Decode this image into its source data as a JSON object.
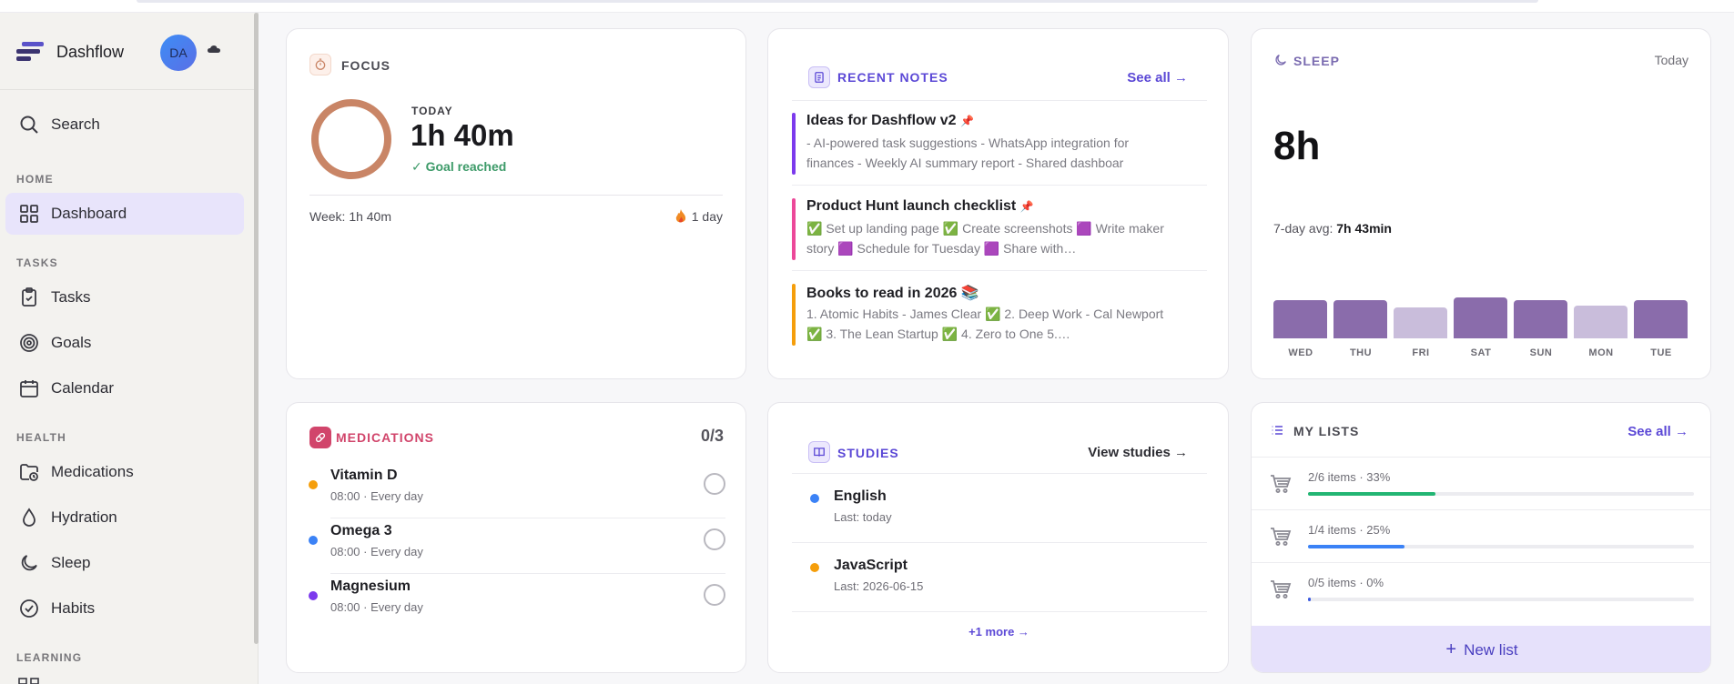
{
  "app": {
    "name": "Dashflow",
    "avatar_initials": "DA"
  },
  "sidebar": {
    "search_label": "Search",
    "sections": {
      "home": "HOME",
      "tasks": "TASKS",
      "health": "HEALTH",
      "learning": "LEARNING"
    },
    "items": {
      "dashboard": "Dashboard",
      "tasks": "Tasks",
      "goals": "Goals",
      "calendar": "Calendar",
      "medications": "Medications",
      "hydration": "Hydration",
      "sleep": "Sleep",
      "habits": "Habits"
    }
  },
  "focus": {
    "title": "FOCUS",
    "today_label": "TODAY",
    "today_time": "1h 40m",
    "goal_status": "✓ Goal reached",
    "week": "Week: 1h 40m",
    "streak": "1 day"
  },
  "notes": {
    "title": "RECENT NOTES",
    "see_all": "See all →",
    "items": [
      {
        "title": "Ideas for Dashflow v2",
        "body": "- AI-powered task suggestions - WhatsApp integration for finances - Weekly AI summary report - Shared dashboar",
        "accent": "#7c3aed",
        "icon": "pin-icon"
      },
      {
        "title": "Product Hunt launch checklist",
        "body": "✅ Set up landing page ✅ Create screenshots 🟪 Write maker story 🟪 Schedule for Tuesday 🟪 Share with…",
        "accent": "#ec4899",
        "icon": "pin-icon"
      },
      {
        "title": "Books to read in 2026 📚",
        "body": "1. Atomic Habits - James Clear ✅ 2. Deep Work - Cal Newport ✅ 3. The Lean Startup ✅ 4. Zero to One 5.…",
        "accent": "#f59e0b"
      }
    ]
  },
  "sleep": {
    "title": "SLEEP",
    "period": "Today",
    "total": "8h",
    "avg_label": "7-day avg:",
    "avg_value": "7h 43min",
    "days": [
      {
        "label": "WED",
        "level": 0.88,
        "color": "#8a6cab"
      },
      {
        "label": "THU",
        "level": 0.88,
        "color": "#8a6cab"
      },
      {
        "label": "FRI",
        "level": 0.7,
        "color": "#c9bddb"
      },
      {
        "label": "SAT",
        "level": 0.94,
        "color": "#8a6cab"
      },
      {
        "label": "SUN",
        "level": 0.88,
        "color": "#8a6cab"
      },
      {
        "label": "MON",
        "level": 0.75,
        "color": "#c9bddb"
      },
      {
        "label": "TUE",
        "level": 0.88,
        "color": "#8a6cab"
      }
    ]
  },
  "medications": {
    "title": "MEDICATIONS",
    "count": "0/3",
    "items": [
      {
        "name": "Vitamin D",
        "schedule": "08:00 · Every day",
        "color": "#f59e0b"
      },
      {
        "name": "Omega 3",
        "schedule": "08:00 · Every day",
        "color": "#3b82f6"
      },
      {
        "name": "Magnesium",
        "schedule": "08:00 · Every day",
        "color": "#7c3aed"
      }
    ]
  },
  "studies": {
    "title": "STUDIES",
    "view_label": "View studies →",
    "items": [
      {
        "name": "English",
        "last": "Last: today",
        "color": "#3b82f6"
      },
      {
        "name": "JavaScript",
        "last": "Last: 2026-06-15",
        "color": "#f59e0b"
      }
    ],
    "more": "+1 more →"
  },
  "lists": {
    "title": "MY LISTS",
    "see_all": "See all →",
    "items": [
      {
        "summary": "2/6 items · 33%",
        "progress": 0.33,
        "color": "#22b573"
      },
      {
        "summary": "1/4 items · 25%",
        "progress": 0.25,
        "color": "#3b82f6"
      },
      {
        "summary": "0/5 items · 0%",
        "progress": 0.0,
        "color": "#3b5ae0"
      }
    ],
    "new_list": "New list"
  },
  "colors": {
    "accent": "#5b48d6",
    "focus_ring": "#c98566",
    "meds": "#d1456b",
    "active_nav_bg": "#e8e4fb"
  }
}
